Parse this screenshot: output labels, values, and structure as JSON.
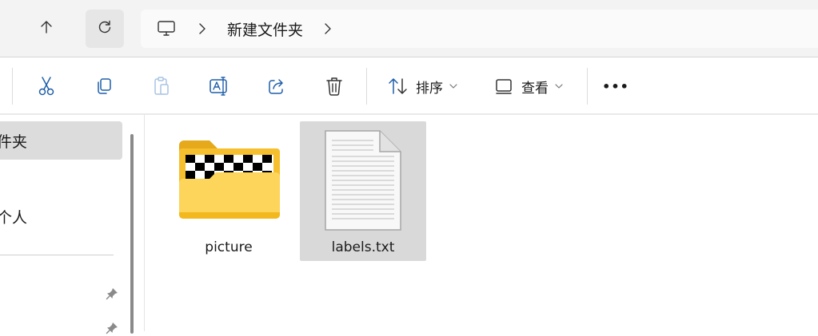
{
  "address_bar": {
    "breadcrumb": "新建文件夹"
  },
  "toolbar": {
    "sort_label": "排序",
    "view_label": "查看",
    "more_label": "•••"
  },
  "nav_pane": {
    "selected_item": "件夹",
    "item_personal": "个人"
  },
  "files": [
    {
      "name": "picture",
      "type": "folder-icon"
    },
    {
      "name": "labels.txt",
      "type": "text-file-icon",
      "selected": true
    }
  ],
  "colors": {
    "folder_yellow": "#f7c23c",
    "selected_bg": "#d9d9d9",
    "accent_blue": "#2f6ab4"
  }
}
